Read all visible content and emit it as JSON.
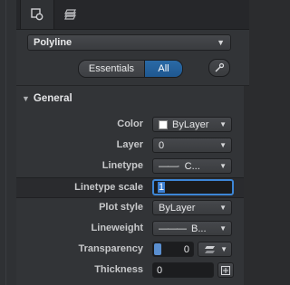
{
  "tabs": {
    "properties_icon": "properties-icon",
    "layers_icon": "layers-icon"
  },
  "object_type": {
    "value": "Polyline"
  },
  "filter": {
    "essentials_label": "Essentials",
    "all_label": "All",
    "selected": "All"
  },
  "section": {
    "title": "General"
  },
  "properties": {
    "color": {
      "label": "Color",
      "value": "ByLayer"
    },
    "layer": {
      "label": "Layer",
      "value": "0"
    },
    "linetype": {
      "label": "Linetype",
      "value": "C..."
    },
    "linetype_scale": {
      "label": "Linetype scale",
      "value": "1"
    },
    "plot_style": {
      "label": "Plot style",
      "value": "ByLayer"
    },
    "lineweight": {
      "label": "Lineweight",
      "value": "B..."
    },
    "transparency": {
      "label": "Transparency",
      "value": "0"
    },
    "thickness": {
      "label": "Thickness",
      "value": "0"
    }
  },
  "colors": {
    "accent": "#3d86d6",
    "panel_bg": "#323437",
    "segment_active": "#1f5890"
  }
}
